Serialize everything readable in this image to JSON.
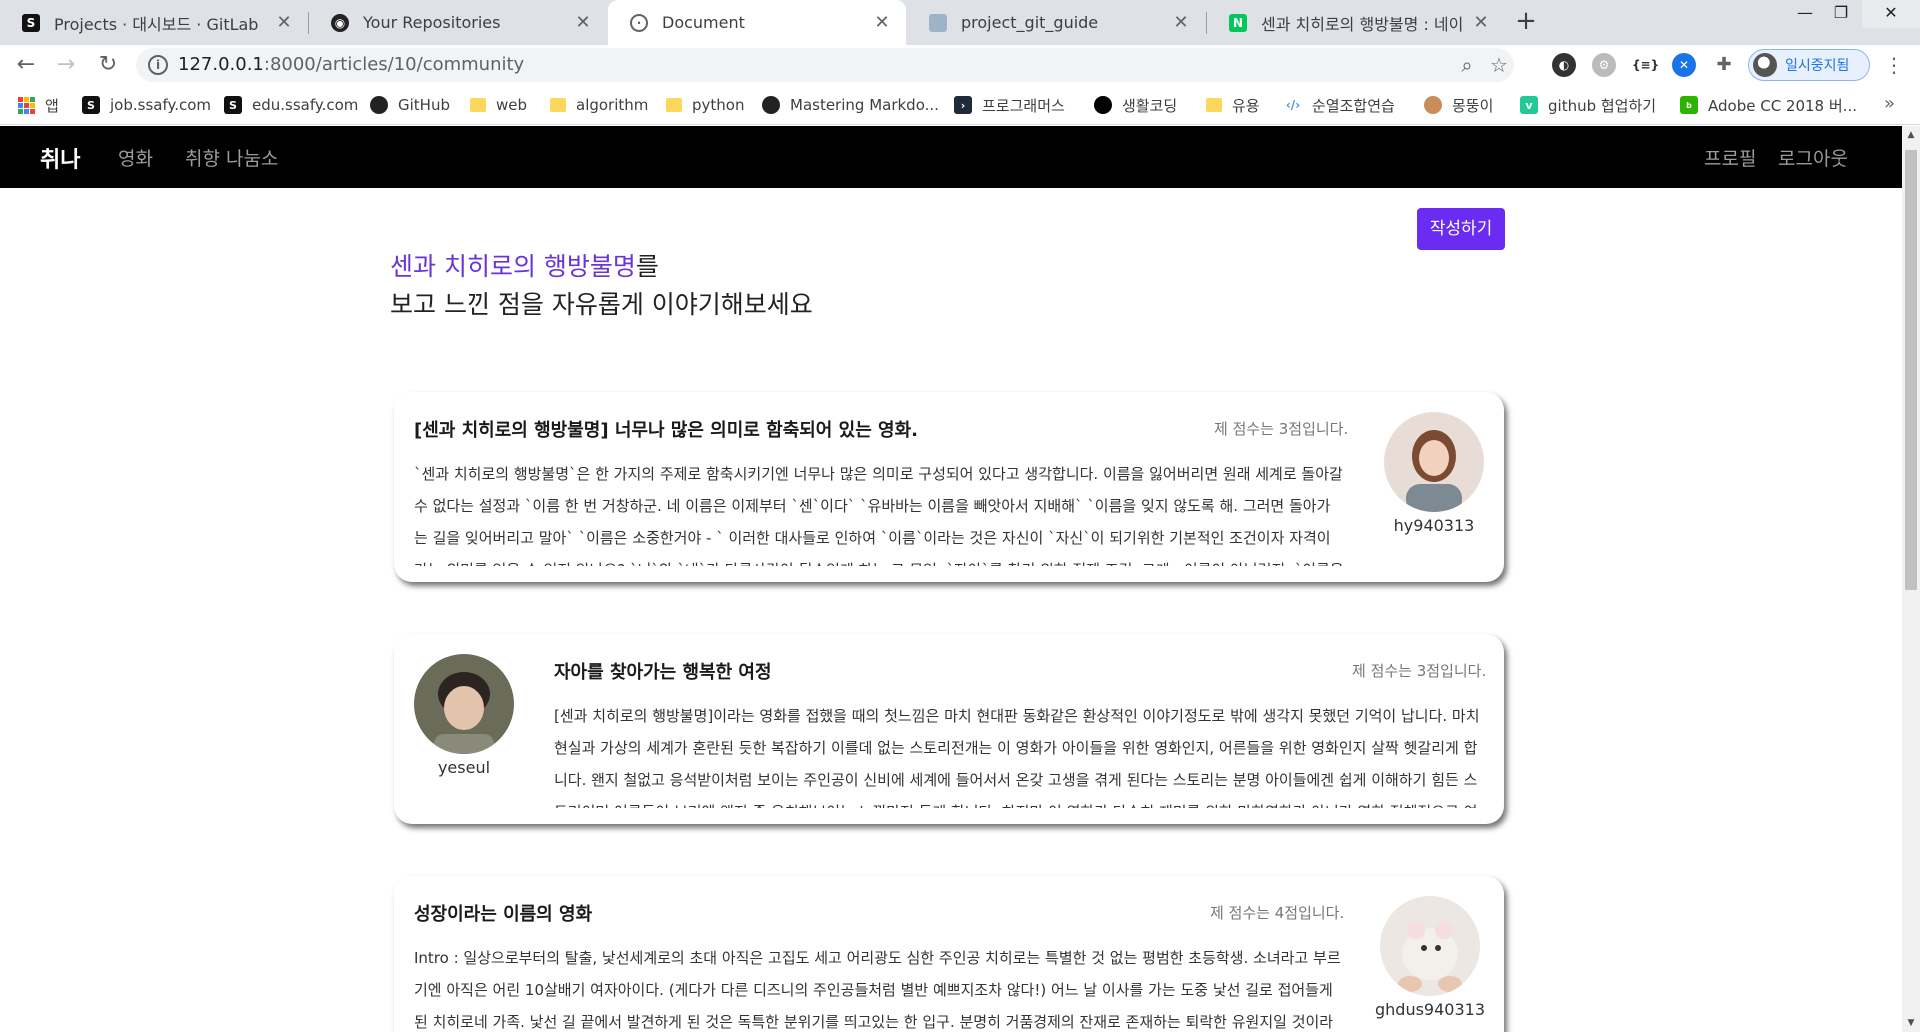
{
  "browser": {
    "tabs": [
      {
        "title": "Projects · 대시보드 · GitLab",
        "icon": "ssafy-gitlab-icon"
      },
      {
        "title": "Your Repositories",
        "icon": "github-icon"
      },
      {
        "title": "Document",
        "icon": "globe-icon"
      },
      {
        "title": "project_git_guide",
        "icon": "document-icon"
      },
      {
        "title": "센과 치히로의 행방불명 : 네이버",
        "icon": "naver-icon"
      }
    ],
    "url_host": "127.0.0.1",
    "url_path": ":8000/articles/10/community",
    "profile_label": "일시중지됨",
    "bookmarks": [
      {
        "label": "앱",
        "icon": "apps-icon"
      },
      {
        "label": "job.ssafy.com",
        "icon": "ssafy-icon"
      },
      {
        "label": "edu.ssafy.com",
        "icon": "ssafy-icon"
      },
      {
        "label": "GitHub",
        "icon": "github-icon"
      },
      {
        "label": "web",
        "icon": "folder-icon"
      },
      {
        "label": "algorithm",
        "icon": "folder-icon"
      },
      {
        "label": "python",
        "icon": "folder-icon"
      },
      {
        "label": "Mastering Markdo...",
        "icon": "github-icon"
      },
      {
        "label": "프로그래머스",
        "icon": "programmers-icon"
      },
      {
        "label": "생활코딩",
        "icon": "circle-icon"
      },
      {
        "label": "유용",
        "icon": "folder-icon"
      },
      {
        "label": "순열조합연습",
        "icon": "code-icon"
      },
      {
        "label": "몽뚱이",
        "icon": "dog-icon"
      },
      {
        "label": "github 협업하기",
        "icon": "velog-icon"
      },
      {
        "label": "Adobe CC 2018 버...",
        "icon": "blog-icon"
      }
    ]
  },
  "site": {
    "brand": "취나",
    "nav_left": [
      "영화",
      "취향 나눔소"
    ],
    "nav_right": [
      "프로필",
      "로그아웃"
    ],
    "write_button": "작성하기",
    "heading_movie": "센과 치히로의 행방불명",
    "heading_suffix": "를",
    "heading_line2": "보고 느낀 점을 자유롭게 이야기해보세요"
  },
  "reviews": [
    {
      "title": "[센과 치히로의 행방불명] 너무나 많은 의미로 함축되어 있는 영화.",
      "score": "제 점수는 3점입니다.",
      "username": "hy940313",
      "body": "`센과 치히로의 행방불명`은 한 가지의 주제로 함축시키기엔 너무나 많은 의미로 구성되어 있다고 생각합니다. 이름을 잃어버리면 원래 세계로 돌아갈 수 없다는 설정과 `이름 한 번 거창하군. 네 이름은 이제부터 `센`이다` `유바바는 이름을 빼앗아서 지배해` `이름을 잊지 않도록 해. 그러면 돌아가는 길을 잊어버리고 말아` `이름은 소중한거야 - ` 이러한 대사들로 인하여 `이름`이라는 것은 자신이 `자신`이 되기위한 기본적인 조건이자 자격이라는 의미를 얻을 수 있지 않나요? `너`와 `내`가 다른사람이 될수있게 하는 그 무엇. `자아`를 찾기 위한 전제 조건, 그게.. 이름이 아닐런지. `이름을 잊어"
    },
    {
      "title": "자아를 찾아가는 행복한 여정",
      "score": "제 점수는 3점입니다.",
      "username": "yeseul",
      "body": "[센과 치히로의 행방불명]이라는 영화를 접했을 때의 첫느낌은 마치 현대판 동화같은 환상적인 이야기정도로 밖에 생각지 못했던 기억이 납니다. 마치 현실과 가상의 세계가 혼란된 듯한 복잡하기 이를데 없는 스토리전개는 이 영화가 아이들을 위한 영화인지, 어른들을 위한 영화인지 살짝 헷갈리게 합니다. 왠지 철없고 응석받이처럼 보이는 주인공이 신비에 세계에 들어서서 온갖 고생을 겪게 된다는 스토리는 분명 아이들에겐 쉽게 이해하기 힘든 스토리이며 어른들이 보기엔 왠지 좀 유치해보이는 느낌마저 들게 합니다. 하지만 이 영화가 단순히 재미를 위한 만화영화가 아니라 영화 전체적으로 여러가지 깊은"
    },
    {
      "title": "성장이라는 이름의 영화",
      "score": "제 점수는 4점입니다.",
      "username": "ghdus940313",
      "body": "Intro : 일상으로부터의 탈출, 낯선세계로의 초대 아직은 고집도 세고 어리광도 심한 주인공 치히로는 특별한 것 없는 평범한 초등학생. 소녀라고 부르기엔 아직은 어린 10살배기 여자아이다. (게다가 다른 디즈니의 주인공들처럼 별반 예쁘지조차 않다!) 어느 날 이사를 가는 도중 낯선 길로 접어들게 된 치히로네 가족. 낯선 길 끝에서 발견하게 된 것은 독특한 분위기를 띄고있는 한 입구. 분명히 거품경제의 잔재로 존재하는 퇴락한 유원지일 것이라는 거침없"
    }
  ]
}
